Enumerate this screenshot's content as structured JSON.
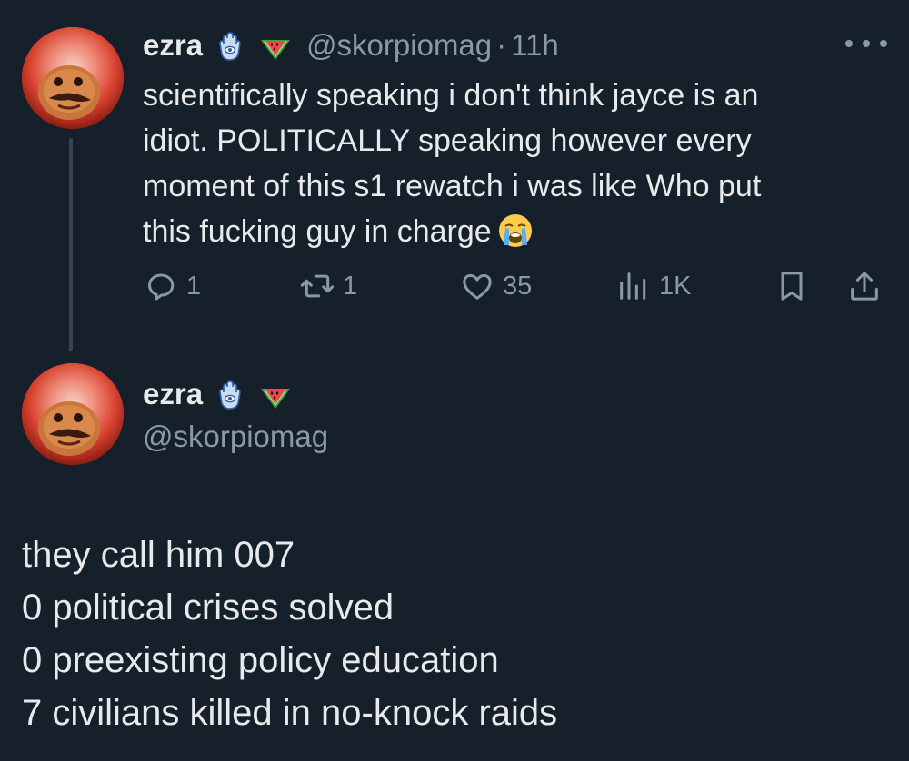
{
  "tweet": {
    "author": {
      "display_name": "ezra",
      "handle": "@skorpiomag",
      "name_emojis": [
        "hamsa-icon",
        "watermelon-icon"
      ]
    },
    "timestamp": "11h",
    "separator": "·",
    "text": [
      "scientifically speaking i don't think jayce is an",
      "idiot. POLITICALLY speaking however every",
      "moment of this s1 rewatch i was like Who put",
      "this fucking guy in charge"
    ],
    "trailing_emoji": "loudly-crying-face-icon",
    "actions": {
      "replies": "1",
      "retweets": "1",
      "likes": "35",
      "views": "1K"
    }
  },
  "main_tweet": {
    "author": {
      "display_name": "ezra",
      "handle": "@skorpiomag",
      "name_emojis": [
        "hamsa-icon",
        "watermelon-icon"
      ]
    },
    "lines": [
      "they call him 007",
      "0 political crises solved",
      "0 preexisting policy education",
      "7 civilians killed in no-knock raids"
    ]
  },
  "colors": {
    "background": "#15202b",
    "primary_text": "#e7e9ea",
    "secondary_text": "#8b98a5",
    "thread_line": "#38444d"
  }
}
